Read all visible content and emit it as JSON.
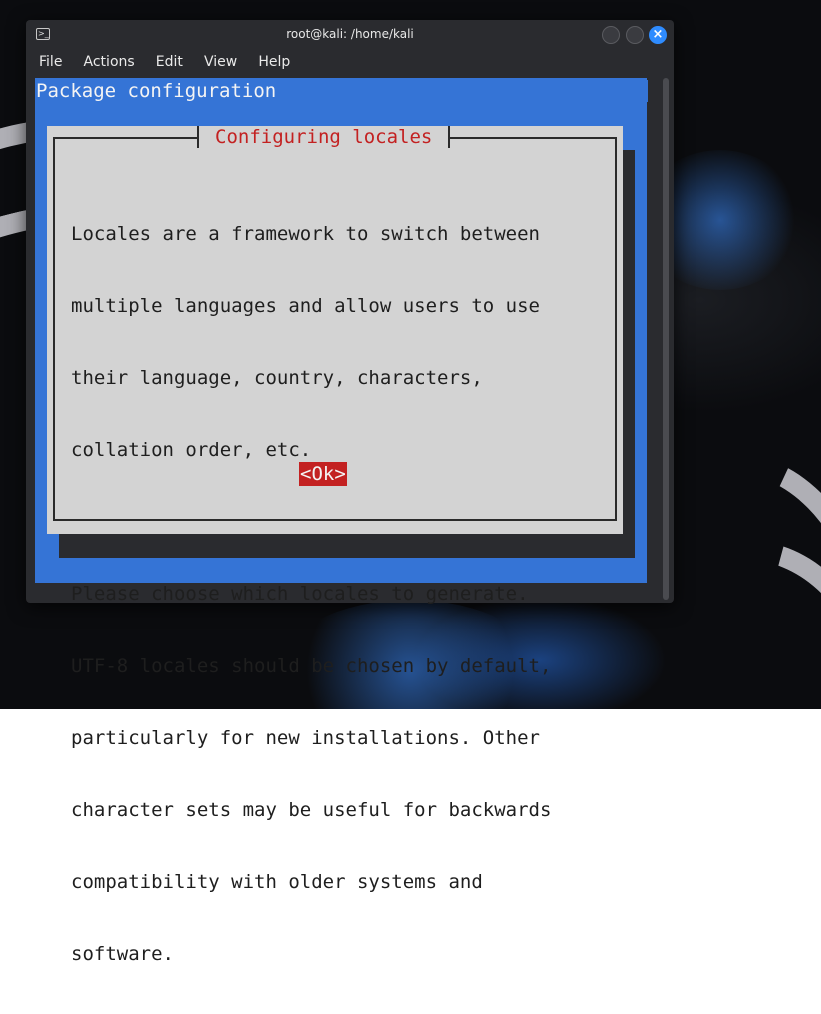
{
  "window": {
    "title": "root@kali: /home/kali",
    "close_glyph": "×"
  },
  "menu": {
    "items": [
      "File",
      "Actions",
      "Edit",
      "View",
      "Help"
    ]
  },
  "terminal": {
    "header": "Package configuration",
    "colors": {
      "background": "#3574d6",
      "dialog": "#d3d3d3",
      "title_text": "#c32121",
      "ok_button": "#c32121"
    },
    "dialog": {
      "title": "Configuring locales",
      "lines": [
        "Locales are a framework to switch between",
        "multiple languages and allow users to use",
        "their language, country, characters,",
        "collation order, etc.",
        "",
        "Please choose which locales to generate.",
        "UTF-8 locales should be chosen by default,",
        "particularly for new installations. Other",
        "character sets may be useful for backwards",
        "compatibility with older systems and",
        "software."
      ],
      "ok_label": "<Ok>"
    }
  },
  "icons": {
    "terminal": "terminal-icon",
    "minimize": "minimize-icon",
    "maximize": "maximize-icon",
    "close": "close-icon"
  }
}
